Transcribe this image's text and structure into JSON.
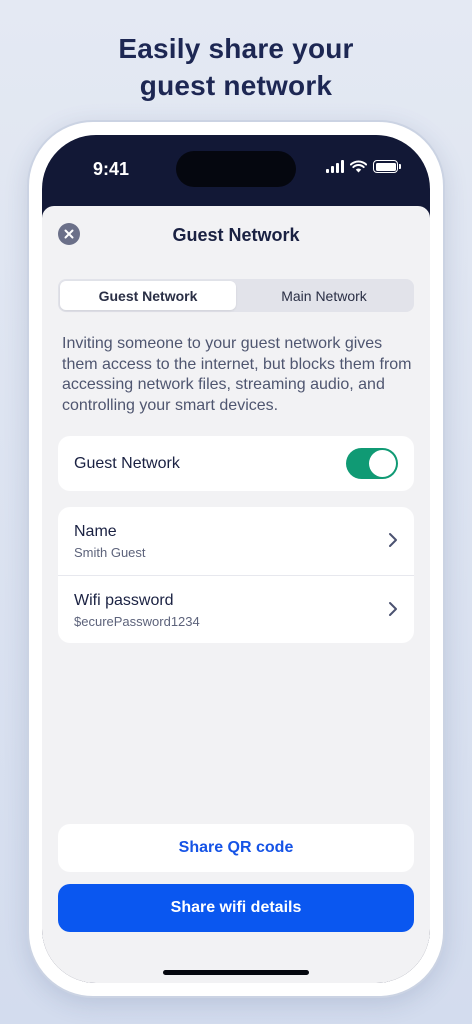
{
  "headline": {
    "line1": "Easily share your",
    "line2": "guest network"
  },
  "status_bar": {
    "time": "9:41",
    "icons": [
      "signal-icon",
      "wifi-icon",
      "battery-icon"
    ]
  },
  "sheet": {
    "title": "Guest Network",
    "close_icon": "close-icon",
    "tabs": [
      {
        "label": "Guest Network",
        "selected": true
      },
      {
        "label": "Main Network",
        "selected": false
      }
    ],
    "description": "Inviting someone to your guest network gives them access to the internet, but blocks them from accessing network files, streaming audio, and controlling your smart devices.",
    "toggle": {
      "label": "Guest Network",
      "on": true
    },
    "rows": [
      {
        "label": "Name",
        "value": "Smith Guest",
        "icon": "chevron-right-icon"
      },
      {
        "label": "Wifi password",
        "value": "$ecurePassword1234",
        "icon": "chevron-right-icon"
      }
    ],
    "share_qr_label": "Share QR code",
    "share_wifi_label": "Share wifi details"
  },
  "colors": {
    "accent": "#0a57f0",
    "toggle_on": "#109a74",
    "headline": "#1d2753",
    "sheet_bg": "#f2f2f4"
  }
}
